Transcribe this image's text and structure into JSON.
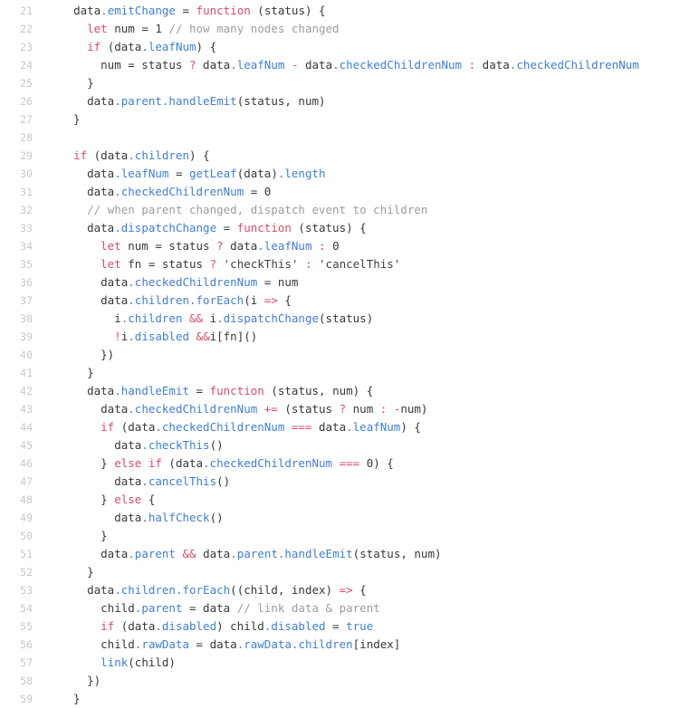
{
  "editor": {
    "language": "javascript",
    "background_color": "#ffffff",
    "text_color": "#383838",
    "gutter_color": "#c8c8c8",
    "first_line_number": 21,
    "last_line_number": 59,
    "colors": {
      "keyword": "#d94b6a",
      "property": "#3f7fd6",
      "function": "#3f7fd6",
      "comment": "#9d9d9d",
      "operator": "#e0496b",
      "string": "#3f3f3f",
      "boolean": "#3f7fd6"
    }
  },
  "lines": [
    {
      "number": "21",
      "tokens": [
        {
          "t": "  ",
          "c": "plain"
        },
        {
          "t": "data",
          "c": "plain"
        },
        {
          "t": ".emitChange",
          "c": "property"
        },
        {
          "t": " = ",
          "c": "plain"
        },
        {
          "t": "function",
          "c": "keyword"
        },
        {
          "t": " (status) {",
          "c": "plain"
        }
      ]
    },
    {
      "number": "22",
      "tokens": [
        {
          "t": "    ",
          "c": "plain"
        },
        {
          "t": "let",
          "c": "keyword"
        },
        {
          "t": " num = ",
          "c": "plain"
        },
        {
          "t": "1",
          "c": "number"
        },
        {
          "t": " ",
          "c": "plain"
        },
        {
          "t": "// how many nodes changed",
          "c": "comment"
        }
      ]
    },
    {
      "number": "23",
      "tokens": [
        {
          "t": "    ",
          "c": "plain"
        },
        {
          "t": "if",
          "c": "keyword"
        },
        {
          "t": " (data",
          "c": "plain"
        },
        {
          "t": ".leafNum",
          "c": "property"
        },
        {
          "t": ") {",
          "c": "plain"
        }
      ]
    },
    {
      "number": "24",
      "tokens": [
        {
          "t": "      num = status ",
          "c": "plain"
        },
        {
          "t": "?",
          "c": "operator"
        },
        {
          "t": " data",
          "c": "plain"
        },
        {
          "t": ".leafNum",
          "c": "property"
        },
        {
          "t": " ",
          "c": "plain"
        },
        {
          "t": "-",
          "c": "operator"
        },
        {
          "t": " data",
          "c": "plain"
        },
        {
          "t": ".checkedChildrenNum",
          "c": "property"
        },
        {
          "t": " ",
          "c": "plain"
        },
        {
          "t": ":",
          "c": "operator"
        },
        {
          "t": " data",
          "c": "plain"
        },
        {
          "t": ".checkedChildrenNum",
          "c": "property"
        }
      ]
    },
    {
      "number": "25",
      "tokens": [
        {
          "t": "    }",
          "c": "plain"
        }
      ]
    },
    {
      "number": "26",
      "tokens": [
        {
          "t": "    data",
          "c": "plain"
        },
        {
          "t": ".parent",
          "c": "property"
        },
        {
          "t": ".handleEmit",
          "c": "function"
        },
        {
          "t": "(status, num)",
          "c": "plain"
        }
      ]
    },
    {
      "number": "27",
      "tokens": [
        {
          "t": "  }",
          "c": "plain"
        }
      ]
    },
    {
      "number": "28",
      "tokens": [
        {
          "t": "",
          "c": "plain"
        }
      ]
    },
    {
      "number": "29",
      "tokens": [
        {
          "t": "  ",
          "c": "plain"
        },
        {
          "t": "if",
          "c": "keyword"
        },
        {
          "t": " (data",
          "c": "plain"
        },
        {
          "t": ".children",
          "c": "property"
        },
        {
          "t": ") {",
          "c": "plain"
        }
      ]
    },
    {
      "number": "30",
      "tokens": [
        {
          "t": "    data",
          "c": "plain"
        },
        {
          "t": ".leafNum",
          "c": "property"
        },
        {
          "t": " = ",
          "c": "plain"
        },
        {
          "t": "getLeaf",
          "c": "function"
        },
        {
          "t": "(data)",
          "c": "plain"
        },
        {
          "t": ".length",
          "c": "property"
        }
      ]
    },
    {
      "number": "31",
      "tokens": [
        {
          "t": "    data",
          "c": "plain"
        },
        {
          "t": ".checkedChildrenNum",
          "c": "property"
        },
        {
          "t": " = ",
          "c": "plain"
        },
        {
          "t": "0",
          "c": "number"
        }
      ]
    },
    {
      "number": "32",
      "tokens": [
        {
          "t": "    ",
          "c": "plain"
        },
        {
          "t": "// when parent changed, dispatch event to children",
          "c": "comment"
        }
      ]
    },
    {
      "number": "33",
      "tokens": [
        {
          "t": "    data",
          "c": "plain"
        },
        {
          "t": ".dispatchChange",
          "c": "property"
        },
        {
          "t": " = ",
          "c": "plain"
        },
        {
          "t": "function",
          "c": "keyword"
        },
        {
          "t": " (status) {",
          "c": "plain"
        }
      ]
    },
    {
      "number": "34",
      "tokens": [
        {
          "t": "      ",
          "c": "plain"
        },
        {
          "t": "let",
          "c": "keyword"
        },
        {
          "t": " num = status ",
          "c": "plain"
        },
        {
          "t": "?",
          "c": "operator"
        },
        {
          "t": " data",
          "c": "plain"
        },
        {
          "t": ".leafNum",
          "c": "property"
        },
        {
          "t": " ",
          "c": "plain"
        },
        {
          "t": ":",
          "c": "operator"
        },
        {
          "t": " ",
          "c": "plain"
        },
        {
          "t": "0",
          "c": "number"
        }
      ]
    },
    {
      "number": "35",
      "tokens": [
        {
          "t": "      ",
          "c": "plain"
        },
        {
          "t": "let",
          "c": "keyword"
        },
        {
          "t": " fn = status ",
          "c": "plain"
        },
        {
          "t": "?",
          "c": "operator"
        },
        {
          "t": " ",
          "c": "plain"
        },
        {
          "t": "'checkThis'",
          "c": "string"
        },
        {
          "t": " ",
          "c": "plain"
        },
        {
          "t": ":",
          "c": "operator"
        },
        {
          "t": " ",
          "c": "plain"
        },
        {
          "t": "'cancelThis'",
          "c": "string"
        }
      ]
    },
    {
      "number": "36",
      "tokens": [
        {
          "t": "      data",
          "c": "plain"
        },
        {
          "t": ".checkedChildrenNum",
          "c": "property"
        },
        {
          "t": " = num",
          "c": "plain"
        }
      ]
    },
    {
      "number": "37",
      "tokens": [
        {
          "t": "      data",
          "c": "plain"
        },
        {
          "t": ".children",
          "c": "property"
        },
        {
          "t": ".forEach",
          "c": "function"
        },
        {
          "t": "(i ",
          "c": "plain"
        },
        {
          "t": "=>",
          "c": "operator"
        },
        {
          "t": " {",
          "c": "plain"
        }
      ]
    },
    {
      "number": "38",
      "tokens": [
        {
          "t": "        i",
          "c": "plain"
        },
        {
          "t": ".children",
          "c": "property"
        },
        {
          "t": " ",
          "c": "plain"
        },
        {
          "t": "&&",
          "c": "operator"
        },
        {
          "t": " i",
          "c": "plain"
        },
        {
          "t": ".dispatchChange",
          "c": "function"
        },
        {
          "t": "(status)",
          "c": "plain"
        }
      ]
    },
    {
      "number": "39",
      "tokens": [
        {
          "t": "        ",
          "c": "plain"
        },
        {
          "t": "!",
          "c": "operator"
        },
        {
          "t": "i",
          "c": "plain"
        },
        {
          "t": ".disabled",
          "c": "property"
        },
        {
          "t": " ",
          "c": "plain"
        },
        {
          "t": "&&",
          "c": "operator"
        },
        {
          "t": "i[fn]()",
          "c": "plain"
        }
      ]
    },
    {
      "number": "40",
      "tokens": [
        {
          "t": "      })",
          "c": "plain"
        }
      ]
    },
    {
      "number": "41",
      "tokens": [
        {
          "t": "    }",
          "c": "plain"
        }
      ]
    },
    {
      "number": "42",
      "tokens": [
        {
          "t": "    data",
          "c": "plain"
        },
        {
          "t": ".handleEmit",
          "c": "property"
        },
        {
          "t": " = ",
          "c": "plain"
        },
        {
          "t": "function",
          "c": "keyword"
        },
        {
          "t": " (status, num) {",
          "c": "plain"
        }
      ]
    },
    {
      "number": "43",
      "tokens": [
        {
          "t": "      data",
          "c": "plain"
        },
        {
          "t": ".checkedChildrenNum",
          "c": "property"
        },
        {
          "t": " ",
          "c": "plain"
        },
        {
          "t": "+=",
          "c": "operator"
        },
        {
          "t": " (status ",
          "c": "plain"
        },
        {
          "t": "?",
          "c": "operator"
        },
        {
          "t": " num ",
          "c": "plain"
        },
        {
          "t": ":",
          "c": "operator"
        },
        {
          "t": " ",
          "c": "plain"
        },
        {
          "t": "-",
          "c": "operator"
        },
        {
          "t": "num)",
          "c": "plain"
        }
      ]
    },
    {
      "number": "44",
      "tokens": [
        {
          "t": "      ",
          "c": "plain"
        },
        {
          "t": "if",
          "c": "keyword"
        },
        {
          "t": " (data",
          "c": "plain"
        },
        {
          "t": ".checkedChildrenNum",
          "c": "property"
        },
        {
          "t": " ",
          "c": "plain"
        },
        {
          "t": "===",
          "c": "operator"
        },
        {
          "t": " data",
          "c": "plain"
        },
        {
          "t": ".leafNum",
          "c": "property"
        },
        {
          "t": ") {",
          "c": "plain"
        }
      ]
    },
    {
      "number": "45",
      "tokens": [
        {
          "t": "        data",
          "c": "plain"
        },
        {
          "t": ".checkThis",
          "c": "function"
        },
        {
          "t": "()",
          "c": "plain"
        }
      ]
    },
    {
      "number": "46",
      "tokens": [
        {
          "t": "      } ",
          "c": "plain"
        },
        {
          "t": "else if",
          "c": "keyword"
        },
        {
          "t": " (data",
          "c": "plain"
        },
        {
          "t": ".checkedChildrenNum",
          "c": "property"
        },
        {
          "t": " ",
          "c": "plain"
        },
        {
          "t": "===",
          "c": "operator"
        },
        {
          "t": " ",
          "c": "plain"
        },
        {
          "t": "0",
          "c": "number"
        },
        {
          "t": ") {",
          "c": "plain"
        }
      ]
    },
    {
      "number": "47",
      "tokens": [
        {
          "t": "        data",
          "c": "plain"
        },
        {
          "t": ".cancelThis",
          "c": "function"
        },
        {
          "t": "()",
          "c": "plain"
        }
      ]
    },
    {
      "number": "48",
      "tokens": [
        {
          "t": "      } ",
          "c": "plain"
        },
        {
          "t": "else",
          "c": "keyword"
        },
        {
          "t": " {",
          "c": "plain"
        }
      ]
    },
    {
      "number": "49",
      "tokens": [
        {
          "t": "        data",
          "c": "plain"
        },
        {
          "t": ".halfCheck",
          "c": "function"
        },
        {
          "t": "()",
          "c": "plain"
        }
      ]
    },
    {
      "number": "50",
      "tokens": [
        {
          "t": "      }",
          "c": "plain"
        }
      ]
    },
    {
      "number": "51",
      "tokens": [
        {
          "t": "      data",
          "c": "plain"
        },
        {
          "t": ".parent",
          "c": "property"
        },
        {
          "t": " ",
          "c": "plain"
        },
        {
          "t": "&&",
          "c": "operator"
        },
        {
          "t": " data",
          "c": "plain"
        },
        {
          "t": ".parent",
          "c": "property"
        },
        {
          "t": ".handleEmit",
          "c": "function"
        },
        {
          "t": "(status, num)",
          "c": "plain"
        }
      ]
    },
    {
      "number": "52",
      "tokens": [
        {
          "t": "    }",
          "c": "plain"
        }
      ]
    },
    {
      "number": "53",
      "tokens": [
        {
          "t": "    data",
          "c": "plain"
        },
        {
          "t": ".children",
          "c": "property"
        },
        {
          "t": ".forEach",
          "c": "function"
        },
        {
          "t": "((child, index) ",
          "c": "plain"
        },
        {
          "t": "=>",
          "c": "operator"
        },
        {
          "t": " {",
          "c": "plain"
        }
      ]
    },
    {
      "number": "54",
      "tokens": [
        {
          "t": "      child",
          "c": "plain"
        },
        {
          "t": ".parent",
          "c": "property"
        },
        {
          "t": " = data ",
          "c": "plain"
        },
        {
          "t": "// link data & parent",
          "c": "comment"
        }
      ]
    },
    {
      "number": "55",
      "tokens": [
        {
          "t": "      ",
          "c": "plain"
        },
        {
          "t": "if",
          "c": "keyword"
        },
        {
          "t": " (data",
          "c": "plain"
        },
        {
          "t": ".disabled",
          "c": "property"
        },
        {
          "t": ") child",
          "c": "plain"
        },
        {
          "t": ".disabled",
          "c": "property"
        },
        {
          "t": " = ",
          "c": "plain"
        },
        {
          "t": "true",
          "c": "boolean"
        }
      ]
    },
    {
      "number": "56",
      "tokens": [
        {
          "t": "      child",
          "c": "plain"
        },
        {
          "t": ".rawData",
          "c": "property"
        },
        {
          "t": " = data",
          "c": "plain"
        },
        {
          "t": ".rawData",
          "c": "property"
        },
        {
          "t": ".children",
          "c": "property"
        },
        {
          "t": "[index]",
          "c": "plain"
        }
      ]
    },
    {
      "number": "57",
      "tokens": [
        {
          "t": "      ",
          "c": "plain"
        },
        {
          "t": "link",
          "c": "function"
        },
        {
          "t": "(child)",
          "c": "plain"
        }
      ]
    },
    {
      "number": "58",
      "tokens": [
        {
          "t": "    })",
          "c": "plain"
        }
      ]
    },
    {
      "number": "59",
      "tokens": [
        {
          "t": "  }",
          "c": "plain"
        }
      ]
    }
  ]
}
